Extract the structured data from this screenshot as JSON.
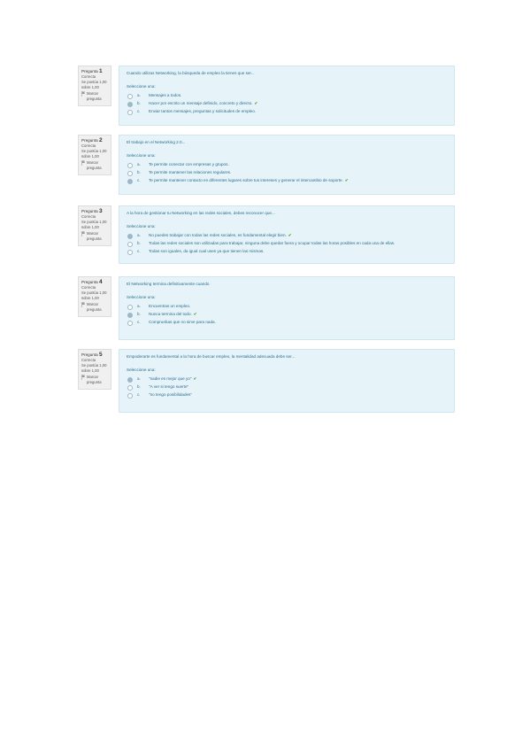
{
  "questions": [
    {
      "number_label": "Pregunta",
      "number": "1",
      "status": "Correcta",
      "score": "Se puntúa 1,00 sobre 1,00",
      "flag_label": "Marcar pregunta",
      "text": "Cuando utilizas Networking, la búsqueda de empleo la tienes que ser...",
      "prompt": "Seleccione una:",
      "options": [
        {
          "letter": "a.",
          "text": "Mensajes a todos.",
          "selected": false,
          "correct": false
        },
        {
          "letter": "b.",
          "text": "Hacer por escrito un mensaje definido, concreto y directo.",
          "selected": true,
          "correct": true
        },
        {
          "letter": "c.",
          "text": "Enviar tantos mensajes, preguntas y solicitudes de empleo.",
          "selected": false,
          "correct": false
        }
      ]
    },
    {
      "number_label": "Pregunta",
      "number": "2",
      "status": "Correcta",
      "score": "Se puntúa 1,00 sobre 1,00",
      "flag_label": "Marcar pregunta",
      "text": "El trabajo en el Networking 2.0...",
      "prompt": "Seleccione una:",
      "options": [
        {
          "letter": "a.",
          "text": "Te permite conectar con empresas y grupos.",
          "selected": false,
          "correct": false
        },
        {
          "letter": "b.",
          "text": "Te permite mantener las relaciones regulares.",
          "selected": false,
          "correct": false
        },
        {
          "letter": "c.",
          "text": "Te permite mantener contacto en diferentes lugares sobre tus intereses y generar el intercambio de soporte.",
          "selected": true,
          "correct": true
        }
      ]
    },
    {
      "number_label": "Pregunta",
      "number": "3",
      "status": "Correcta",
      "score": "Se puntúa 1,00 sobre 1,00",
      "flag_label": "Marcar pregunta",
      "text": "A la hora de gestionar tu Networking en las redes sociales, debes reconocer que...",
      "prompt": "Seleccione una:",
      "options": [
        {
          "letter": "a.",
          "text": "No puedes trabajar con todas las redes sociales, es fundamental elegir bien.",
          "selected": true,
          "correct": true
        },
        {
          "letter": "b.",
          "text": "Todas las redes sociales son utilizadas para trabajar, ninguna debe quedar fuera y ocupar todas las horas posibles en cada una de ellas.",
          "selected": false,
          "correct": false
        },
        {
          "letter": "c.",
          "text": "Todas son iguales, da igual cual uses ya que tienen las mismas.",
          "selected": false,
          "correct": false
        }
      ]
    },
    {
      "number_label": "Pregunta",
      "number": "4",
      "status": "Correcta",
      "score": "Se puntúa 1,00 sobre 1,00",
      "flag_label": "Marcar pregunta",
      "text": "El Networking termina definitivamente cuando",
      "prompt": "Seleccione una:",
      "options": [
        {
          "letter": "a.",
          "text": "Encuentras un empleo.",
          "selected": false,
          "correct": false
        },
        {
          "letter": "b.",
          "text": "Nunca termina del todo.",
          "selected": true,
          "correct": true
        },
        {
          "letter": "c.",
          "text": "Compruebas que no sirve para nada.",
          "selected": false,
          "correct": false
        }
      ]
    },
    {
      "number_label": "Pregunta",
      "number": "5",
      "status": "Correcta",
      "score": "Se puntúa 1,00 sobre 1,00",
      "flag_label": "Marcar pregunta",
      "text": "Empoderarte es fundamental a la hora de buscar empleo, la mentalidad adecuada debe ser...",
      "prompt": "Seleccione una:",
      "options": [
        {
          "letter": "a.",
          "text": "\"nadie es mejor que yo\"",
          "selected": true,
          "correct": true
        },
        {
          "letter": "b.",
          "text": "\"A ver si tengo suerte\"",
          "selected": false,
          "correct": false
        },
        {
          "letter": "c.",
          "text": "\"no tengo posibilidades\"",
          "selected": false,
          "correct": false
        }
      ]
    }
  ],
  "icons": {
    "correct_mark": "✔",
    "flag": "flag-icon"
  },
  "colors": {
    "panel_bg": "#e6f3f9",
    "info_bg": "#f0f0f0",
    "correct": "#5aa02c",
    "text": "#2a6f8f"
  }
}
